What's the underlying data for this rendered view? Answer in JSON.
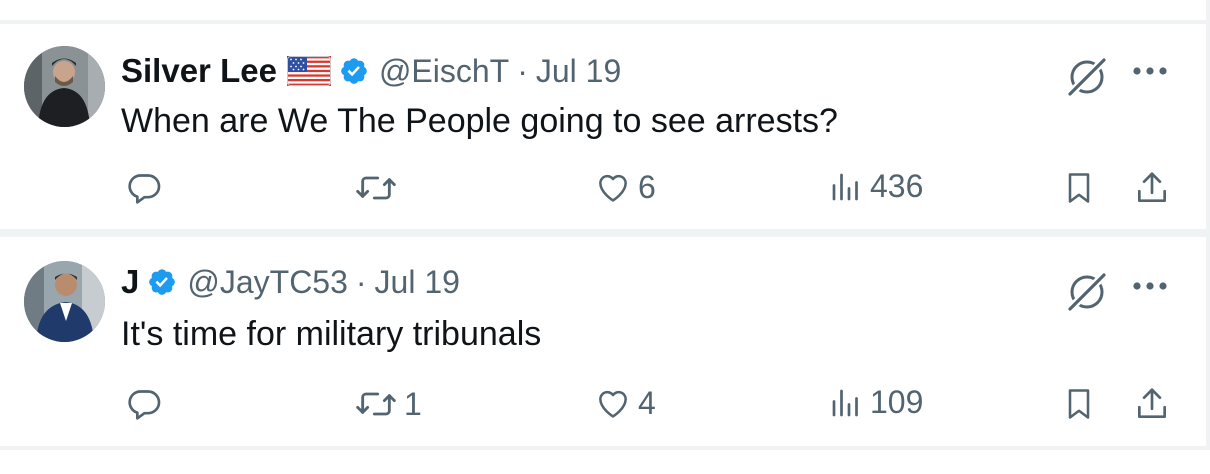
{
  "tweets": [
    {
      "name": "Silver Lee",
      "handle": "@EischT",
      "separator": "·",
      "date": "Jul 19",
      "text": "When are We The People going to see arrests?",
      "replies": "",
      "retweets": "",
      "likes": "6",
      "views": "436"
    },
    {
      "name": "J",
      "handle": "@JayTC53",
      "separator": "·",
      "date": "Jul 19",
      "text": "It's time for military tribunals",
      "replies": "",
      "retweets": "1",
      "likes": "4",
      "views": "109"
    }
  ],
  "colors": {
    "text": "#0f1419",
    "secondary": "#536471",
    "verified": "#1d9bf0",
    "divider": "#eff3f4"
  },
  "icons": [
    "us-flag-icon",
    "verified-badge-icon",
    "grok-icon",
    "more-icon",
    "reply-icon",
    "retweet-icon",
    "like-icon",
    "views-icon",
    "bookmark-icon",
    "share-icon"
  ]
}
